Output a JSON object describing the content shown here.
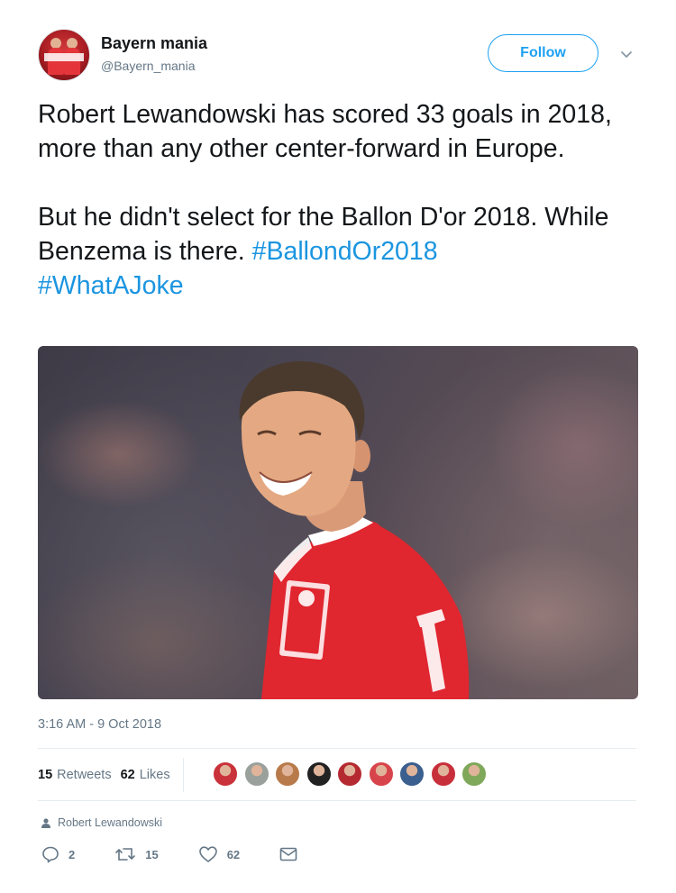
{
  "user": {
    "name": "Bayern mania",
    "handle": "@Bayern_mania",
    "follow_label": "Follow"
  },
  "tweet": {
    "paragraph_1": "Robert Lewandowski has scored 33 goals in 2018, more than any other center-forward in Europe.",
    "paragraph_2_text": "But he didn't select for the Ballon D'or 2018. While Benzema is there.",
    "hashtag_1": "#BallondOr2018",
    "hashtag_2": "#WhatAJoke",
    "timestamp": "3:16 AM - 9 Oct 2018"
  },
  "stats": {
    "retweets_count": "15",
    "retweets_label": "Retweets",
    "likes_count": "62",
    "likes_label": "Likes"
  },
  "liker_colors": [
    "#c9323a",
    "#9aa09b",
    "#b87a4a",
    "#222222",
    "#b52a31",
    "#d8444b",
    "#3b5f8e",
    "#c72f3b",
    "#7fa85a"
  ],
  "reply_context": "Robert Lewandowski",
  "actions": {
    "replies": "2",
    "retweets": "15",
    "likes": "62"
  },
  "colors": {
    "accent": "#1da1f2",
    "hashtag": "#1b95e0",
    "text": "#14171a",
    "muted": "#657786"
  }
}
